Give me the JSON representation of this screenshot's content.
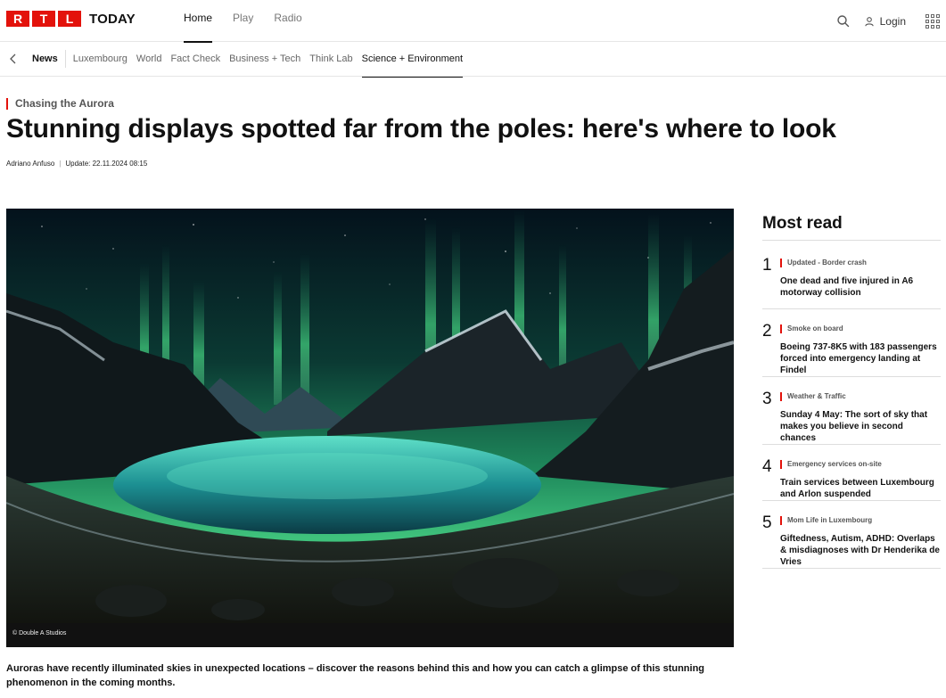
{
  "brand": {
    "letters": [
      "R",
      "T",
      "L"
    ],
    "word": "TODAY",
    "color": "#e3120b"
  },
  "main_nav": [
    {
      "label": "Home",
      "active": true
    },
    {
      "label": "Play",
      "active": false
    },
    {
      "label": "Radio",
      "active": false
    }
  ],
  "header_tools": {
    "search_icon": "search-icon",
    "login_label": "Login",
    "apps_icon": "grid-icon"
  },
  "section_nav": {
    "back_icon": "chevron-left-icon",
    "items": [
      {
        "label": "News",
        "active": false
      },
      {
        "label": "Luxembourg",
        "active": false
      },
      {
        "label": "World",
        "active": false
      },
      {
        "label": "Fact Check",
        "active": false
      },
      {
        "label": "Business + Tech",
        "active": false
      },
      {
        "label": "Think Lab",
        "active": false
      },
      {
        "label": "Science + Environment",
        "active": true
      }
    ]
  },
  "article": {
    "kicker": "Chasing the Aurora",
    "headline": "Stunning displays spotted far from the poles: here's where to look",
    "author": "Adriano Anfuso",
    "updated": "Update: 22.11.2024 08:15",
    "image_credit": "© Double A Studios",
    "lead": "Auroras have recently illuminated skies in unexpected locations – discover the reasons behind this and how you can catch a glimpse of this stunning phenomenon in the coming months."
  },
  "most_read": {
    "title": "Most read",
    "items": [
      {
        "number": "1",
        "category": "Updated - Border crash",
        "headline": "One dead and five injured in A6 motorway collision"
      },
      {
        "number": "2",
        "category": "Smoke on board",
        "headline": "Boeing 737-8K5 with 183 passengers forced into emergency landing at Findel"
      },
      {
        "number": "3",
        "category": "Weather & Traffic",
        "headline": "Sunday 4 May: The sort of sky that makes you believe in second chances"
      },
      {
        "number": "4",
        "category": "Emergency services on-site",
        "headline": "Train services between Luxembourg and Arlon suspended"
      },
      {
        "number": "5",
        "category": "Mom Life in Luxembourg",
        "headline": "Giftedness, Autism, ADHD: Overlaps & misdiagnoses with Dr Henderika de Vries"
      }
    ]
  }
}
